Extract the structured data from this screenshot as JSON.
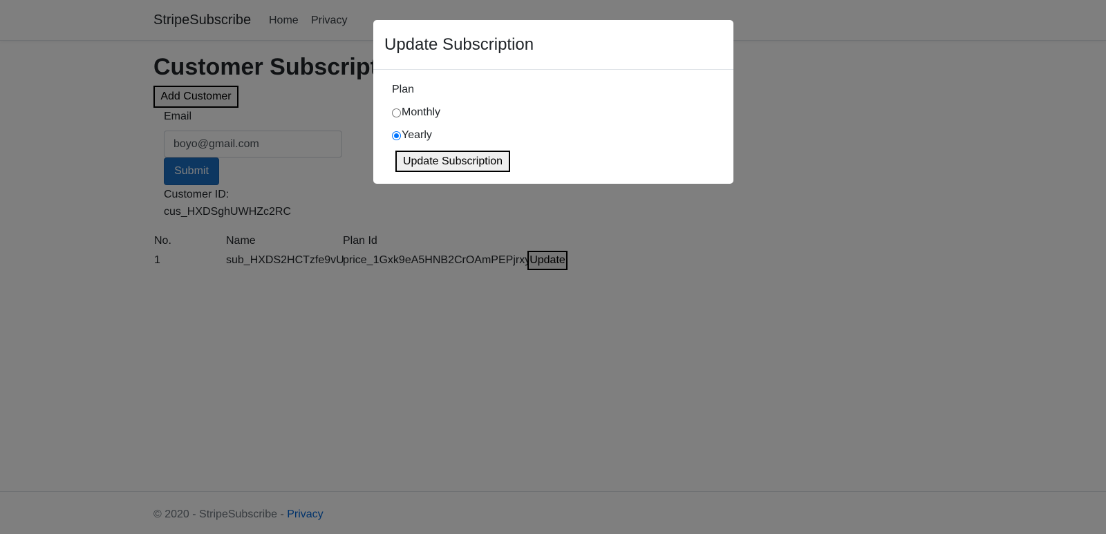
{
  "nav": {
    "brand": "StripeSubscribe",
    "links": [
      "Home",
      "Privacy"
    ]
  },
  "main": {
    "title": "Customer Subscriptions",
    "add_customer_label": "Add Customer",
    "email_label": "Email",
    "email_value": "boyo@gmail.com",
    "submit_label": "Submit",
    "customer_id_label": "Customer ID:",
    "customer_id_value": "cus_HXDSghUWHZc2RC"
  },
  "table": {
    "headers": [
      "No.",
      "Name",
      "Plan Id"
    ],
    "rows": [
      {
        "no": "1",
        "name": "sub_HXDS2HCTzfe9vU",
        "plan_id": "price_1Gxk9eA5HNB2CrOAmPEPjrxy",
        "action": "Update"
      }
    ]
  },
  "footer": {
    "text": "© 2020 - StripeSubscribe - ",
    "link": "Privacy"
  },
  "modal": {
    "title": "Update Subscription",
    "plan_label": "Plan",
    "options": [
      {
        "label": "Monthly",
        "selected": false
      },
      {
        "label": "Yearly",
        "selected": true
      }
    ],
    "submit_label": "Update Subscription"
  },
  "colors": {
    "primary_button": "#1b6ec2",
    "link": "#0366d6",
    "backdrop": "rgba(0,0,0,0.5)"
  }
}
